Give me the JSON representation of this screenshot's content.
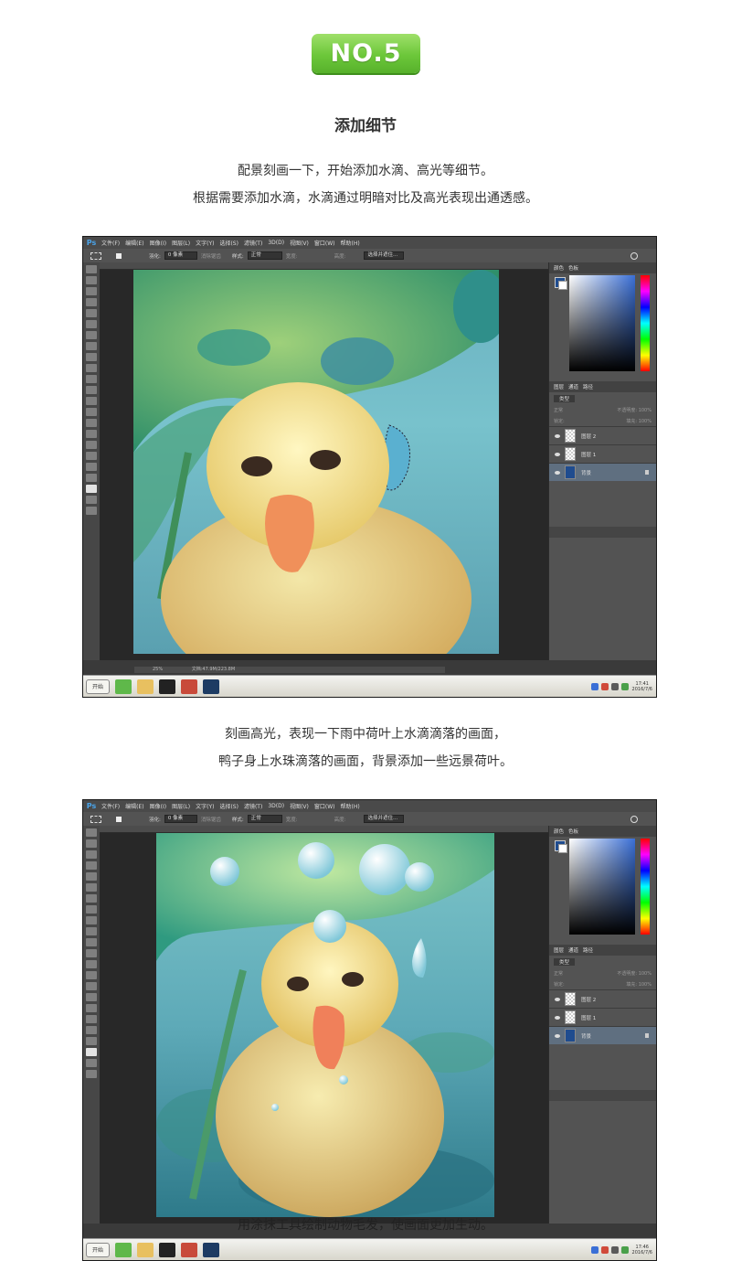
{
  "badge": {
    "label": "NO.5"
  },
  "section_title": "添加细节",
  "intro": {
    "line1": "配景刻画一下，开始添加水滴、高光等细节。",
    "line2": "根据需要添加水滴，水滴通过明暗对比及高光表现出通透感。"
  },
  "middle": {
    "line1": "刻画高光，表现一下雨中荷叶上水滴滴落的画面，",
    "line2": "鸭子身上水珠滴落的画面，背景添加一些远景荷叶。"
  },
  "bottom_caption": "用涂抹工具绘制动物毛发，使画面更加生动。",
  "ps": {
    "app_logo": "Ps",
    "menu": [
      "文件(F)",
      "编辑(E)",
      "图像(I)",
      "图层(L)",
      "文字(Y)",
      "选择(S)",
      "滤镜(T)",
      "3D(D)",
      "视图(V)",
      "窗口(W)",
      "帮助(H)"
    ],
    "options": {
      "feather_label": "羽化:",
      "feather_value": "0 像素",
      "antialias": "消除锯齿",
      "style_label": "样式:",
      "style_value": "正常",
      "width_label": "宽度:",
      "height_label": "高度:",
      "select_mask": "选择并遮住..."
    },
    "color_tabs": [
      "颜色",
      "色板"
    ],
    "layer_tabs": [
      "图层",
      "通道",
      "路径"
    ],
    "layer_kind": "类型",
    "blend_mode": "正常",
    "opacity_label": "不透明度: 100%",
    "fill_label": "填充: 100%",
    "lock_label": "锁定:",
    "layers": [
      {
        "name": "图层 2"
      },
      {
        "name": "图层 1"
      },
      {
        "name": "背景"
      }
    ],
    "zoom": "25%",
    "doc_info": "文档:47.9M/223.8M",
    "start_button": "开始",
    "clock_time": "17:41",
    "clock_date": "2016/7/6",
    "clock_time_2": "17:46",
    "clock_date_2": "2016/7/6"
  },
  "colors": {
    "badge_green": "#6cc73a",
    "ps_dark": "#3a3a3a",
    "ps_panel": "#535353",
    "layer_selected": "#5f6f80",
    "foreground_color": "#1f4c8f"
  }
}
